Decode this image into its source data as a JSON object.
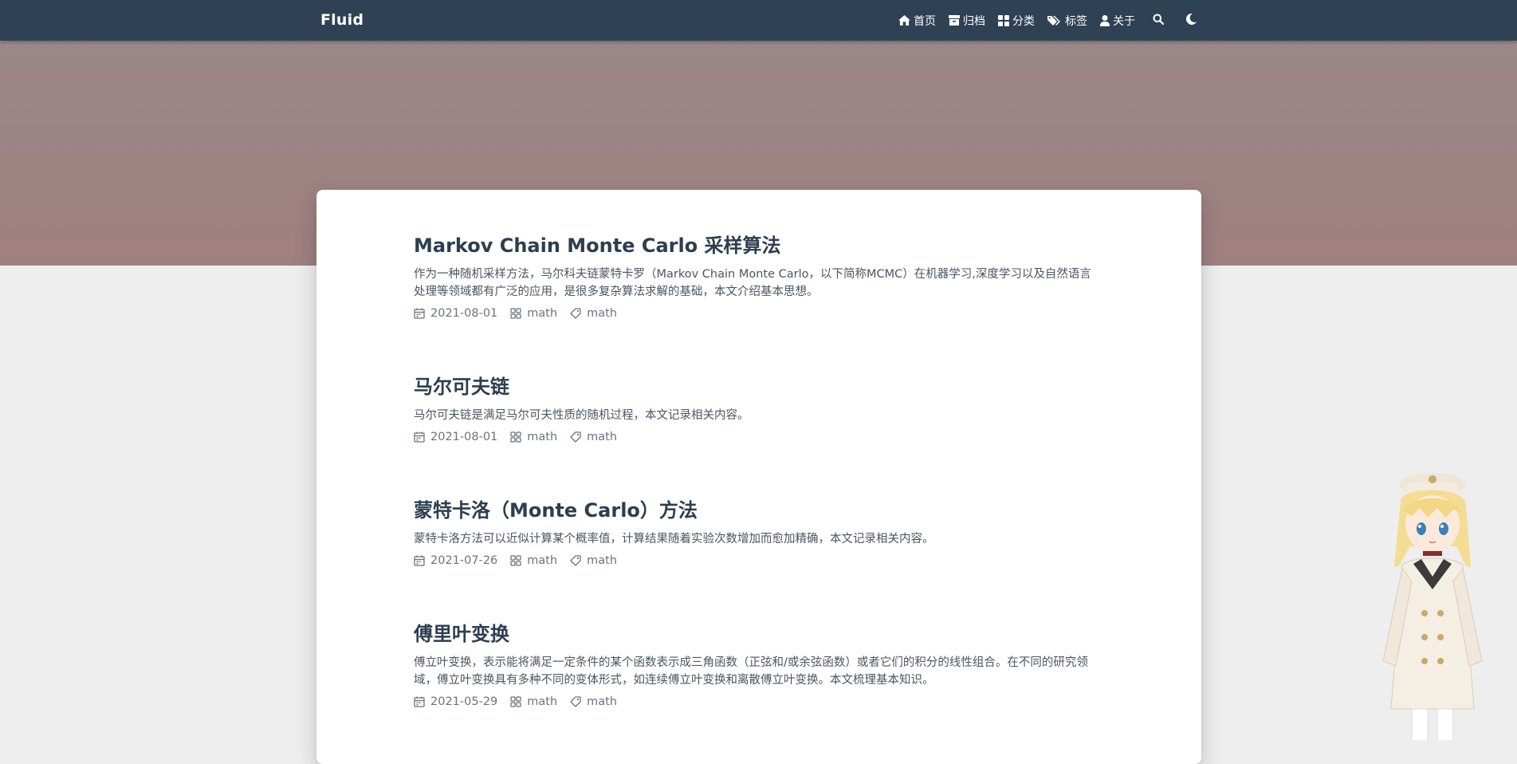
{
  "nav": {
    "brand": "Fluid",
    "items": [
      {
        "label": "首页",
        "icon": "home-icon"
      },
      {
        "label": "归档",
        "icon": "archive-icon"
      },
      {
        "label": "分类",
        "icon": "categories-icon"
      },
      {
        "label": "标签",
        "icon": "tags-icon"
      },
      {
        "label": "关于",
        "icon": "user-icon"
      }
    ],
    "search_icon": "search-icon",
    "theme_icon": "moon-icon"
  },
  "colors": {
    "navbar": "#2f4154",
    "banner": "#9b8888",
    "title": "#2c3e50",
    "text": "#4b5563",
    "meta": "#6b7280"
  },
  "posts": [
    {
      "title": "Markov Chain Monte Carlo 采样算法",
      "excerpt": "作为一种随机采样方法，马尔科夫链蒙特卡罗（Markov Chain Monte Carlo，以下简称MCMC）在机器学习,深度学习以及自然语言处理等领域都有广泛的应用，是很多复杂算法求解的基础，本文介绍基本思想。",
      "date": "2021-08-01",
      "category": "math",
      "tag": "math"
    },
    {
      "title": "马尔可夫链",
      "excerpt": "马尔可夫链是满足马尔可夫性质的随机过程，本文记录相关内容。",
      "date": "2021-08-01",
      "category": "math",
      "tag": "math"
    },
    {
      "title": "蒙特卡洛（Monte Carlo）方法",
      "excerpt": "蒙特卡洛方法可以近似计算某个概率值，计算结果随着实验次数增加而愈加精确，本文记录相关内容。",
      "date": "2021-07-26",
      "category": "math",
      "tag": "math"
    },
    {
      "title": "傅里叶变换",
      "excerpt": "傅立叶变换，表示能将满足一定条件的某个函数表示成三角函数（正弦和/或余弦函数）或者它们的积分的线性组合。在不同的研究领域，傅立叶变换具有多种不同的变体形式，如连续傅立叶变换和离散傅立叶变换。本文梳理基本知识。",
      "date": "2021-05-29",
      "category": "math",
      "tag": "math"
    }
  ]
}
